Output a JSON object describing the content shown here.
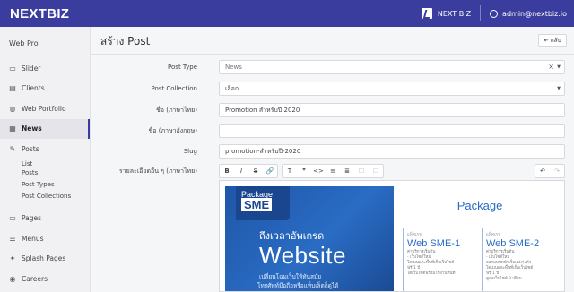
{
  "brand": {
    "logo": "NEXTBIZ",
    "right_label": "NEXT BIZ",
    "user": "admin@nextbiz.io",
    "accent": "#3b3d9e"
  },
  "sidebar": {
    "title": "Web Pro",
    "items": [
      {
        "label": "Slider",
        "icon": "slider-icon"
      },
      {
        "label": "Clients",
        "icon": "clients-icon"
      },
      {
        "label": "Web Portfolio",
        "icon": "globe-icon"
      },
      {
        "label": "News",
        "icon": "news-icon",
        "active": true
      },
      {
        "label": "Posts",
        "icon": "pencil-icon"
      }
    ],
    "posts_sub": [
      "List Posts",
      "Post Types",
      "Post Collections"
    ],
    "items2": [
      {
        "label": "Pages",
        "icon": "pages-icon"
      },
      {
        "label": "Menus",
        "icon": "menu-icon"
      },
      {
        "label": "Splash Pages",
        "icon": "splash-icon"
      },
      {
        "label": "Careers",
        "icon": "careers-icon"
      }
    ]
  },
  "main": {
    "title": "สร้าง Post",
    "back_label": "กลับ",
    "form": {
      "post_type": {
        "label": "Post Type",
        "value": "News"
      },
      "post_collection": {
        "label": "Post Collection",
        "value": "เลือก"
      },
      "name_th": {
        "label": "ชื่อ (ภาษาไทย)",
        "value": "Promotion สำหรับปี 2020"
      },
      "name_en": {
        "label": "ชื่อ (ภาษาอังกฤษ)",
        "value": ""
      },
      "slug": {
        "label": "Slug",
        "value": "promotion-สำหรับปี-2020"
      },
      "detail": {
        "label": "รายละเอียดอื่น ๆ (ภาษาไทย)"
      }
    },
    "toolbar": {
      "g1": [
        "B",
        "I",
        "S",
        "🔗"
      ],
      "g2": [
        "T",
        "❞",
        "<>",
        "≡",
        "≣",
        "☐",
        "☐"
      ],
      "g3": [
        "↶",
        "↷"
      ]
    },
    "banner": {
      "badge_top": "Package",
      "badge_main": "SME",
      "line1": "ถึงเวลาอัพเกรด",
      "line2": "Website",
      "line3": "เปลี่ยนโฉมเว็บให้ทันสมัย",
      "line4": "โทรศัพท์มือถือหรือแท็บเล็ตก็ดูได้"
    },
    "package": {
      "title": "Package",
      "plans": [
        {
          "tag": "แพ็คเกจ",
          "name": "Web SME-1",
          "sub": "ค่าบริการเริ่มต้น",
          "notes": [
            "- เว็บไซต์ใหม่",
            "โดเมนและพื้นที่เก็บเว็บไซต์",
            "ฟรี 1 ปี",
            "ได้เว็บไซต์พร้อมใช้งานทันที"
          ]
        },
        {
          "tag": "แพ็คเกจ",
          "name": "Web SME-2",
          "sub": "ค่าบริการเริ่มต้น",
          "notes": [
            "- เว็บไซต์ใหม่",
            "ออกแบบหน้าเว็บเฉพาะตัว",
            "โดเมนและพื้นที่เก็บเว็บไซต์",
            "ฟรี 1 ปี",
            "ดูแลเว็บไซต์ 3 เดือน"
          ]
        }
      ]
    }
  }
}
